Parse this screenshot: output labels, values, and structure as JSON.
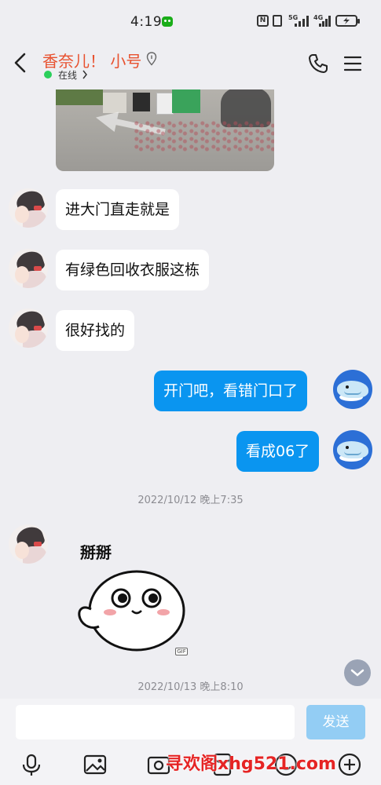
{
  "status_bar": {
    "time": "4:19",
    "network_1": "5G",
    "network_2": "4G"
  },
  "header": {
    "contact_name": "香奈儿！ 小号",
    "presence": "在线"
  },
  "messages": [
    {
      "id": "m1",
      "direction": "in",
      "text": "进大门直走就是"
    },
    {
      "id": "m2",
      "direction": "in",
      "text": "有绿色回收衣服这栋"
    },
    {
      "id": "m3",
      "direction": "in",
      "text": "很好找的"
    },
    {
      "id": "m4",
      "direction": "out",
      "text": "开门吧，看错门口了"
    },
    {
      "id": "m5",
      "direction": "out",
      "text": "看成06了"
    }
  ],
  "timestamps": [
    "2022/10/12 晚上7:35",
    "2022/10/13 晚上8:10"
  ],
  "sticker": {
    "caption": "掰掰",
    "badge": "GIF"
  },
  "input": {
    "value": "",
    "send_label": "发送"
  },
  "toolbar": {
    "items": [
      "microphone-icon",
      "image-icon",
      "camera-icon",
      "hongbao-icon",
      "emoji-icon",
      "plus-icon"
    ]
  },
  "watermark": "寻欢阁xhg521.com",
  "colors": {
    "accent": "#0a95f0",
    "name": "#e8512f",
    "online": "#2bcf5b",
    "watermark": "#e52424"
  }
}
